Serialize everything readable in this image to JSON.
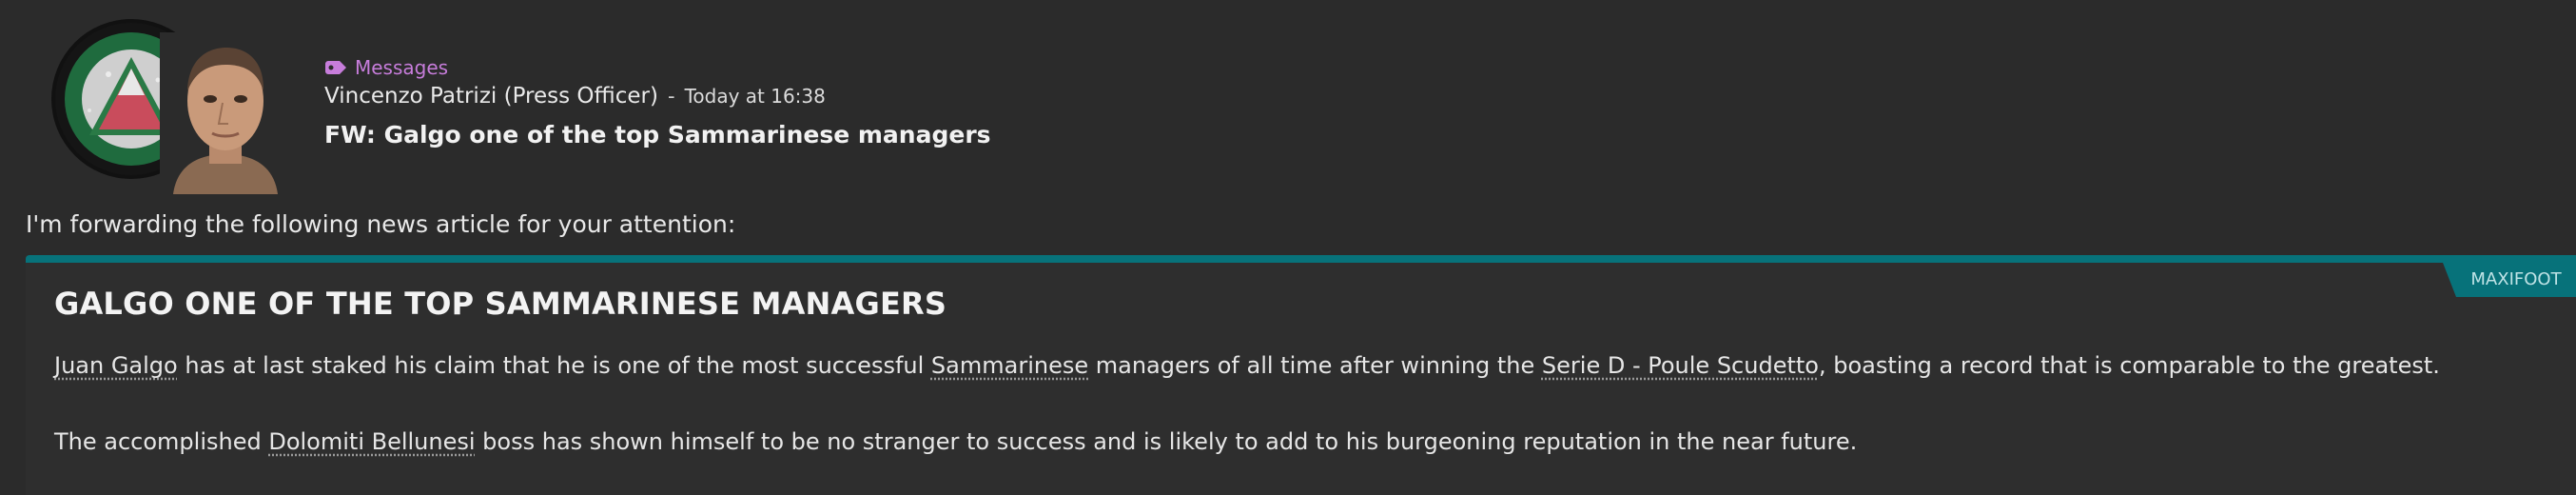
{
  "colors": {
    "background": "#2b2b2b",
    "category_accent": "#c77ddb",
    "article_accent": "#07727a"
  },
  "header": {
    "category_icon": "tag-icon",
    "category": "Messages",
    "sender": "Vincenzo Patrizi (Press Officer)",
    "separator": "-",
    "time": "Today at 16:38",
    "subject": "FW: Galgo one of the top Sammarinese managers"
  },
  "body": {
    "intro": "I'm forwarding the following news article for your attention:"
  },
  "article": {
    "source": "MAXIFOOT",
    "headline": "GALGO ONE OF THE TOP SAMMARINESE MANAGERS",
    "para1": {
      "link_person": "Juan Galgo",
      "text_a": " has at last staked his claim that he is one of the most successful ",
      "link_nation": "Sammarinese",
      "text_b": " managers of all time after winning the ",
      "link_competition": "Serie D - Poule Scudetto",
      "text_c": ", boasting a record that is comparable to the greatest."
    },
    "para2": {
      "text_a": "The accomplished ",
      "link_club": "Dolomiti Bellunesi",
      "text_b": " boss has shown himself to be no stranger to success and is likely to add to his burgeoning reputation in the near future."
    }
  }
}
